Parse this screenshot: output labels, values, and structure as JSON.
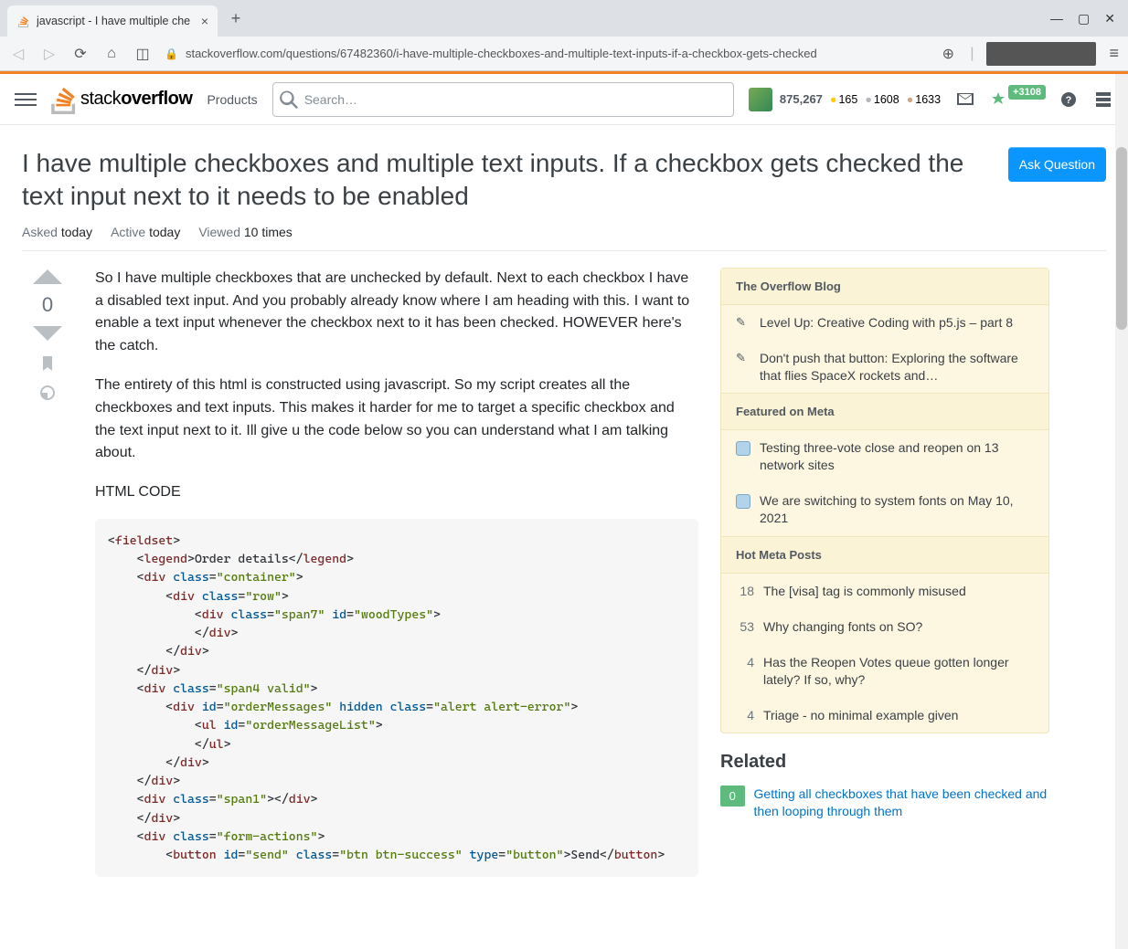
{
  "browser": {
    "tab_title": "javascript - I have multiple che",
    "url_display": "stackoverflow.com/questions/67482360/i-have-multiple-checkboxes-and-multiple-text-inputs-if-a-checkbox-gets-checked"
  },
  "topbar": {
    "products": "Products",
    "search_placeholder": "Search…",
    "reputation": "875,267",
    "badge_gold": "165",
    "badge_silver": "1608",
    "badge_bronze": "1633",
    "achievements": "+3108"
  },
  "question": {
    "title": "I have multiple checkboxes and multiple text inputs. If a checkbox gets checked the text input next to it needs to be enabled",
    "ask_button": "Ask Question",
    "asked_label": "Asked",
    "asked_value": "today",
    "active_label": "Active",
    "active_value": "today",
    "viewed_label": "Viewed",
    "viewed_value": "10 times",
    "vote_count": "0",
    "para1": "So I have multiple checkboxes that are unchecked by default. Next to each checkbox I have a disabled text input. And you probably already know where I am heading with this. I want to enable a text input whenever the checkbox next to it has been checked. HOWEVER here's the catch.",
    "para2": "The entirety of this html is constructed using javascript. So my script creates all the checkboxes and text inputs. This makes it harder for me to target a specific checkbox and the text input next to it. Ill give u the code below so you can understand what I am talking about.",
    "code_heading": "HTML CODE"
  },
  "sidebar": {
    "blog_header": "The Overflow Blog",
    "blog_items": [
      "Level Up: Creative Coding with p5.js – part 8",
      "Don't push that button: Exploring the software that flies SpaceX rockets and…"
    ],
    "meta_header": "Featured on Meta",
    "meta_items": [
      "Testing three-vote close and reopen on 13 network sites",
      "We are switching to system fonts on May 10, 2021"
    ],
    "hot_header": "Hot Meta Posts",
    "hot_items": [
      {
        "votes": "18",
        "text": "The [visa] tag is commonly misused"
      },
      {
        "votes": "53",
        "text": "Why changing fonts on SO?"
      },
      {
        "votes": "4",
        "text": "Has the Reopen Votes queue gotten longer lately? If so, why?"
      },
      {
        "votes": "4",
        "text": "Triage - no minimal example given"
      }
    ],
    "related_header": "Related",
    "related_items": [
      {
        "score": "0",
        "text": "Getting all checkboxes that have been checked and then looping through them"
      }
    ]
  }
}
